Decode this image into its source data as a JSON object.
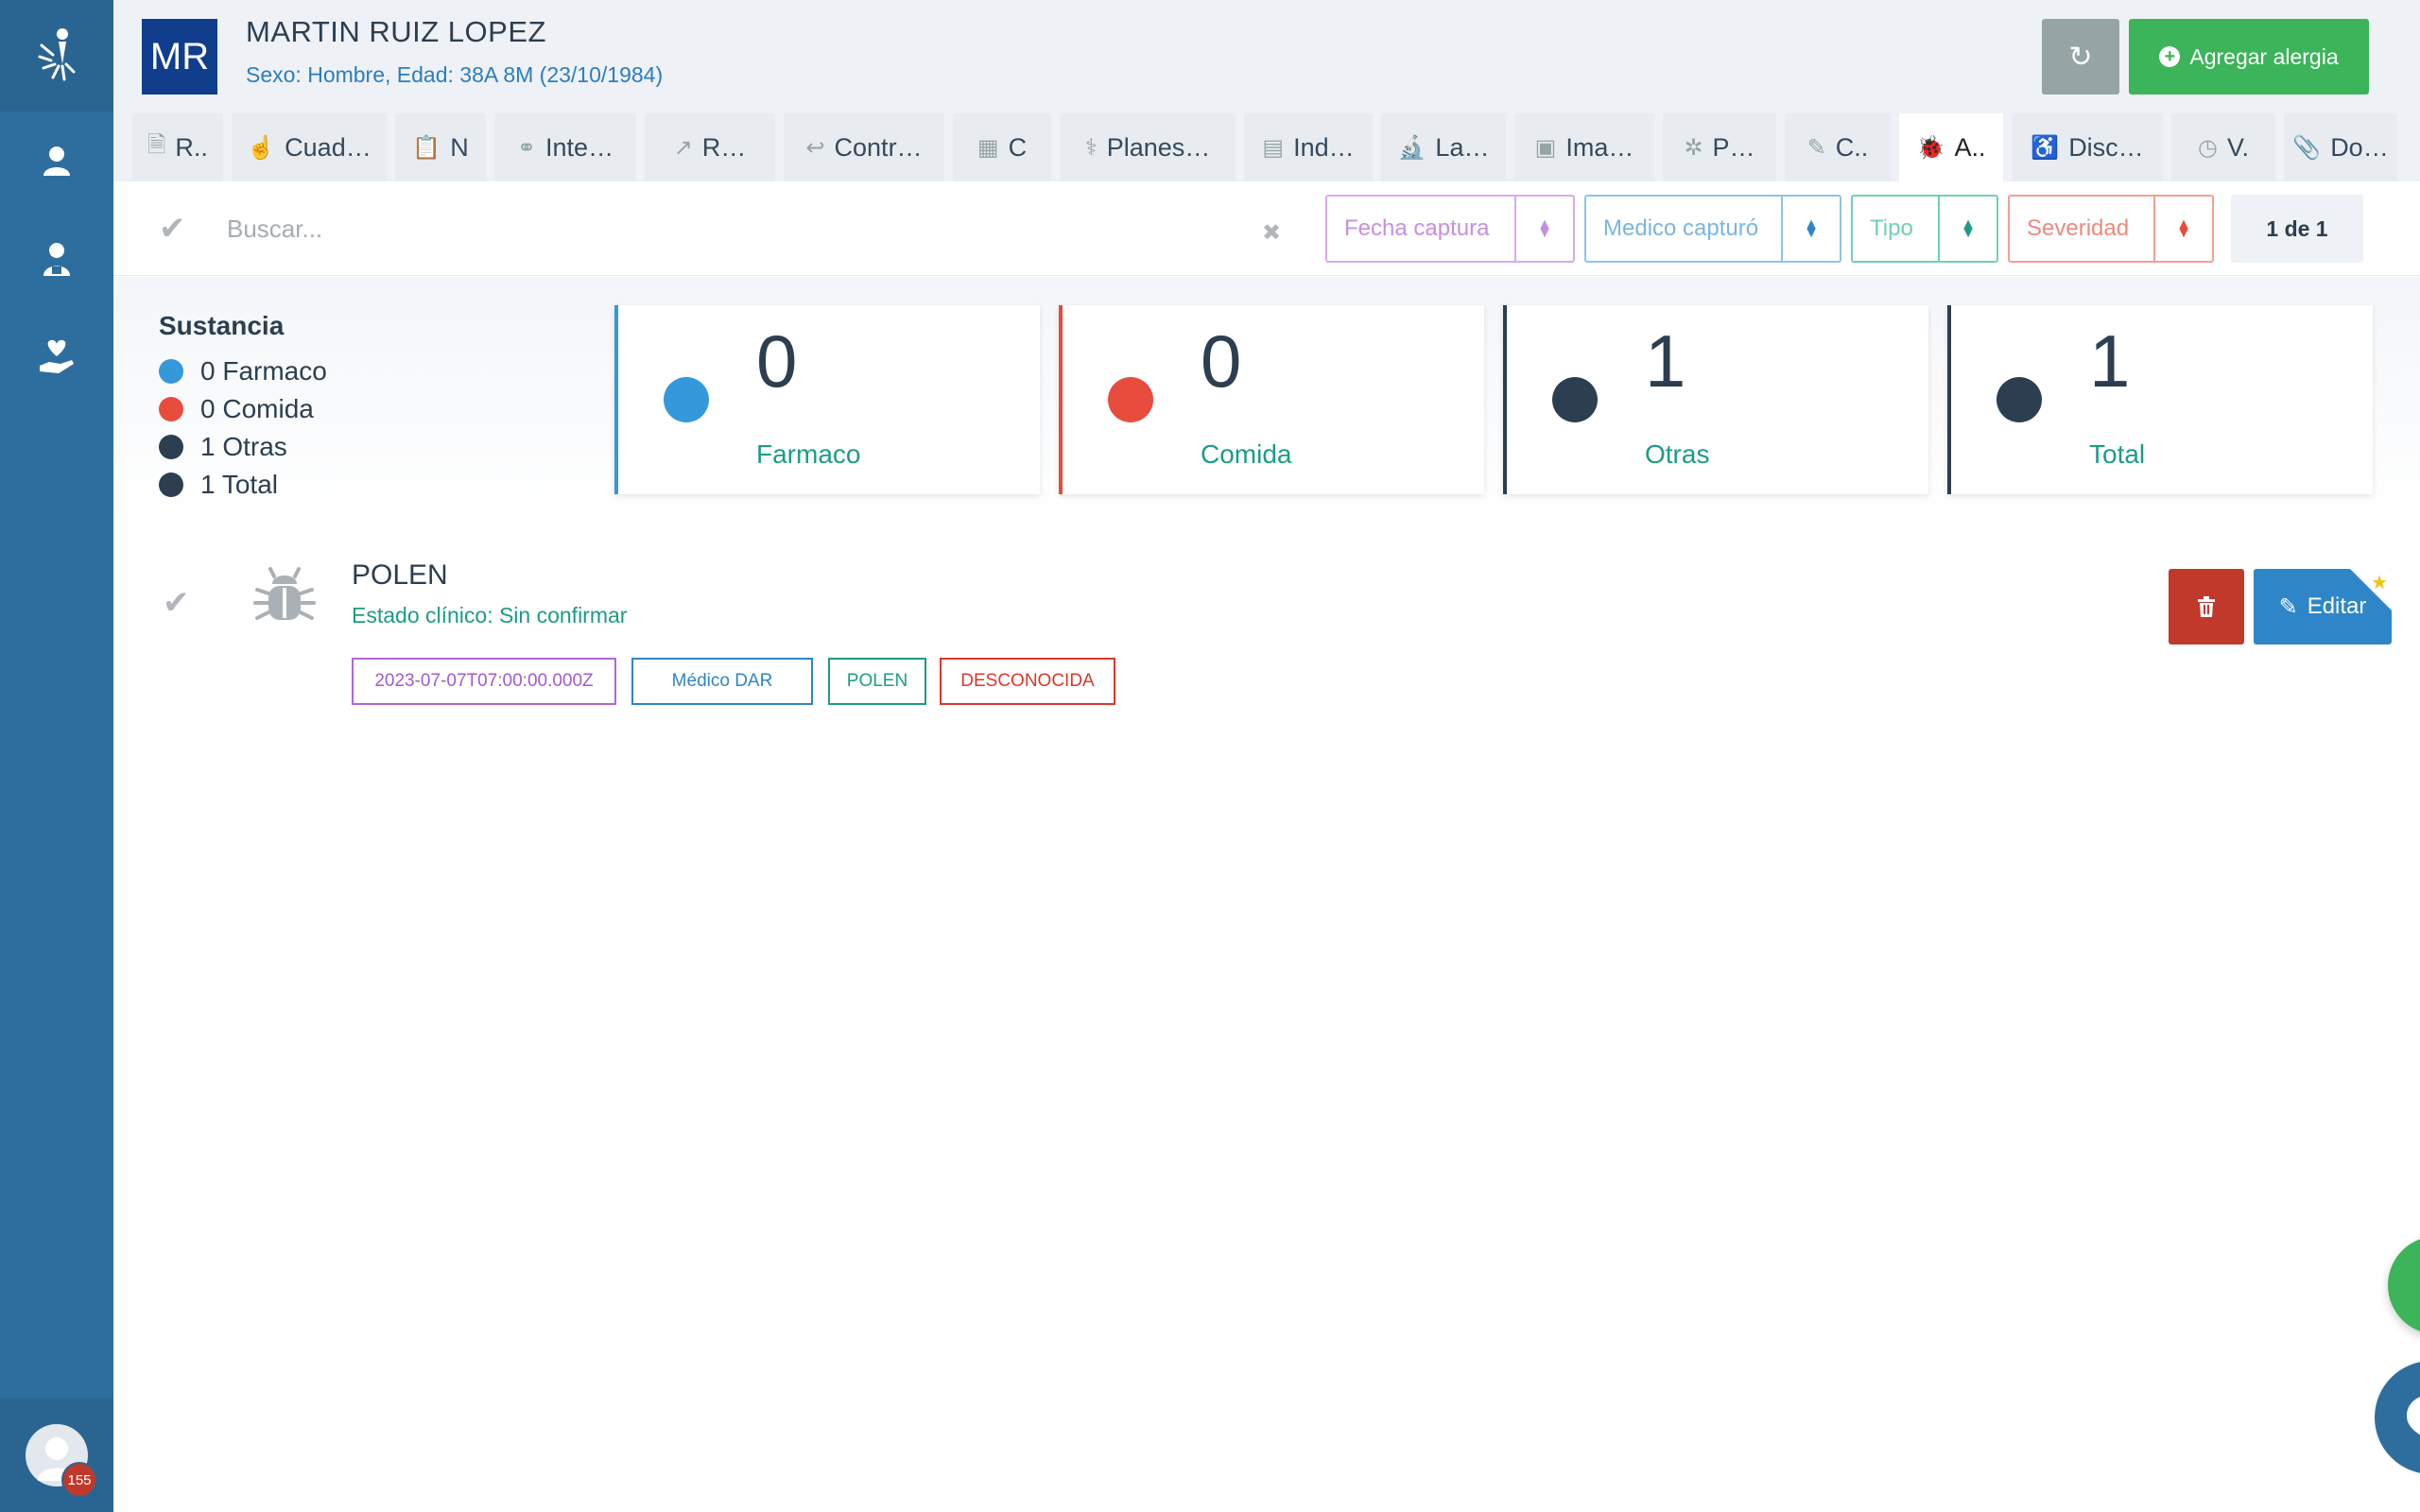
{
  "patient": {
    "initials": "MR",
    "name": "MARTIN RUIZ LOPEZ",
    "info": "Sexo: Hombre, Edad: 38A 8M (23/10/1984)"
  },
  "header": {
    "add_label": "Agregar alergia",
    "refresh_icon": "refresh-icon"
  },
  "tabs": [
    {
      "label": "R..",
      "icon": "medical-file-icon"
    },
    {
      "label": "Cuad…",
      "icon": "hand-icon"
    },
    {
      "label": "N",
      "icon": "clipboard-check-icon"
    },
    {
      "label": "Inte…",
      "icon": "molecule-icon"
    },
    {
      "label": "R…",
      "icon": "share-icon"
    },
    {
      "label": "Contr…",
      "icon": "reply-icon"
    },
    {
      "label": "C",
      "icon": "calendar-icon"
    },
    {
      "label": "Planes…",
      "icon": "pills-icon"
    },
    {
      "label": "Ind…",
      "icon": "document-icon"
    },
    {
      "label": "La…",
      "icon": "microscope-icon"
    },
    {
      "label": "Ima…",
      "icon": "image-icon"
    },
    {
      "label": "P…",
      "icon": "virus-icon"
    },
    {
      "label": "C..",
      "icon": "pen-icon"
    },
    {
      "label": "A..",
      "icon": "bug-icon",
      "active": true
    },
    {
      "label": "Disc…",
      "icon": "wheelchair-icon"
    },
    {
      "label": "V.",
      "icon": "clock-icon"
    },
    {
      "label": "Do…",
      "icon": "paperclip-icon"
    }
  ],
  "toolbar": {
    "search_placeholder": "Buscar...",
    "filters": {
      "fecha": "Fecha captura",
      "medico": "Medico capturó",
      "tipo": "Tipo",
      "severidad": "Severidad"
    },
    "pager": "1 de 1"
  },
  "legend": {
    "title": "Sustancia",
    "items": [
      {
        "label": "0 Farmaco",
        "color": "#3498db"
      },
      {
        "label": "0 Comida",
        "color": "#e74c3c"
      },
      {
        "label": "1 Otras",
        "color": "#2c3e50"
      },
      {
        "label": "1 Total",
        "color": "#2c3e50"
      }
    ]
  },
  "cards": [
    {
      "value": "0",
      "label": "Farmaco",
      "color": "#3498db"
    },
    {
      "value": "0",
      "label": "Comida",
      "color": "#e74c3c"
    },
    {
      "value": "1",
      "label": "Otras",
      "color": "#2c3e50"
    },
    {
      "value": "1",
      "label": "Total",
      "color": "#2c3e50"
    }
  ],
  "allergy": {
    "name": "POLEN",
    "status": "Estado clínico: Sin confirmar",
    "tags": {
      "date": "2023-07-07T07:00:00.000Z",
      "doctor": "Médico DAR",
      "substance": "POLEN",
      "severity": "DESCONOCIDA"
    },
    "edit_label": "Editar"
  },
  "user": {
    "notifications": "155"
  },
  "colors": {
    "sidebar": "#2e6e9e",
    "accent_green": "#3cb45a",
    "accent_blue": "#2e86c9",
    "danger": "#c0392b",
    "teal_text": "#1c9c86"
  }
}
